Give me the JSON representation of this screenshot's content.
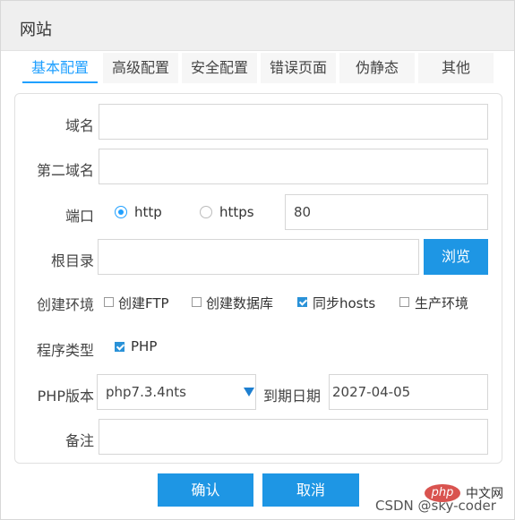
{
  "dialog": {
    "title": "网站"
  },
  "tabs": [
    {
      "label": "基本配置",
      "active": true
    },
    {
      "label": "高级配置",
      "active": false
    },
    {
      "label": "安全配置",
      "active": false
    },
    {
      "label": "错误页面",
      "active": false
    },
    {
      "label": "伪静态",
      "active": false
    },
    {
      "label": "其他",
      "active": false
    }
  ],
  "form": {
    "domain": {
      "label": "域名",
      "value": ""
    },
    "second_domain": {
      "label": "第二域名",
      "value": ""
    },
    "port": {
      "label": "端口",
      "options": [
        {
          "label": "http",
          "selected": true
        },
        {
          "label": "https",
          "selected": false
        }
      ],
      "value": "80"
    },
    "root_dir": {
      "label": "根目录",
      "value": "",
      "browse_label": "浏览"
    },
    "env": {
      "label": "创建环境",
      "options": [
        {
          "label": "创建FTP",
          "checked": false
        },
        {
          "label": "创建数据库",
          "checked": false
        },
        {
          "label": "同步hosts",
          "checked": true
        },
        {
          "label": "生产环境",
          "checked": false
        }
      ]
    },
    "program_type": {
      "label": "程序类型",
      "options": [
        {
          "label": "PHP",
          "checked": true
        }
      ]
    },
    "php_version": {
      "label": "PHP版本",
      "selected": "php7.3.4nts"
    },
    "expire_date": {
      "label": "到期日期",
      "value": "2027-04-05"
    },
    "note": {
      "label": "备注",
      "value": ""
    }
  },
  "actions": {
    "confirm": "确认",
    "cancel": "取消"
  },
  "watermark": {
    "text": "CSDN @sky-coder",
    "php_logo": "php",
    "php_site": "中文网"
  },
  "colors": {
    "accent": "#20a0ff",
    "button": "#1e96e4",
    "php_logo": "#d9534f"
  }
}
